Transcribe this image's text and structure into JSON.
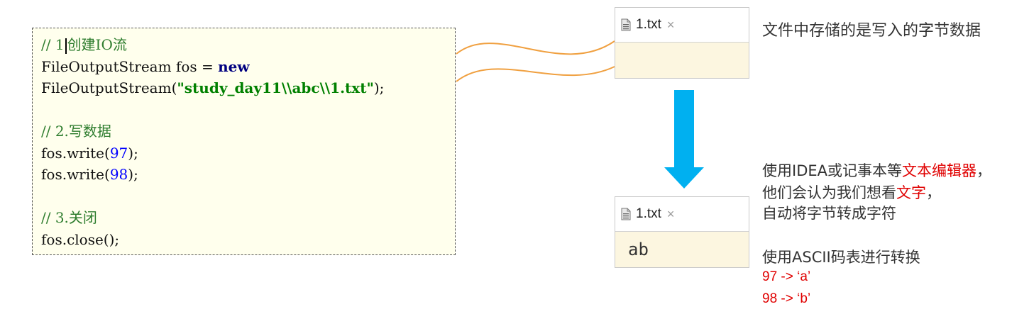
{
  "code": {
    "comment1_prefix": "// 1",
    "comment1_rest": "创建IO流",
    "line2_plain": "FileOutputStream fos = ",
    "line2_kw": "new",
    "line3_plain": "FileOutputStream(",
    "line3_str": "\"study_day11\\\\abc\\\\1.txt\"",
    "line3_end": ");",
    "comment2_prefix": "// 2.",
    "comment2_rest": "写数据",
    "write1_pre": "fos.write(",
    "write1_num": "97",
    "write1_post": ");",
    "write2_pre": "fos.write(",
    "write2_num": "98",
    "write2_post": ");",
    "comment3_prefix": "// 3.",
    "comment3_rest": "关闭",
    "close_line": "fos.close();"
  },
  "file_top": {
    "tab_label": "1.txt",
    "close_glyph": "×",
    "content": ""
  },
  "file_bottom": {
    "tab_label": "1.txt",
    "close_glyph": "×",
    "content": "ab"
  },
  "notes": {
    "stored_bytes": "文件中存储的是写入的字节数据",
    "editor_prefix": "使用IDEA或记事本等",
    "editor_highlight": "文本编辑器",
    "editor_suffix": "，",
    "think_prefix": "他们会认为我们想看",
    "think_highlight": "文字",
    "think_suffix": "，",
    "auto_convert": "自动将字节转成字符",
    "ascii_line": "使用ASCII码表进行转换",
    "map_97": "97 -> ‘a’",
    "map_98": "98 -> ‘b’"
  },
  "colors": {
    "connector": "#f0a040",
    "arrow": "#00b0f0",
    "highlight_text": "#e00000",
    "code_background": "#ffffed",
    "file_content_background": "#fcf6e0"
  }
}
